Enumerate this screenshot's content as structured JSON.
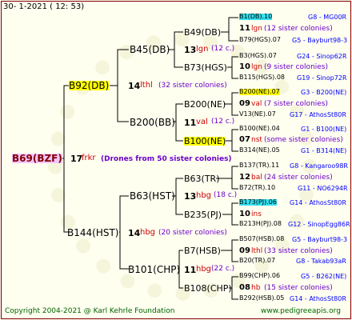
{
  "header": {
    "line": "30-   1-2021  ( 12:  53)"
  },
  "root": {
    "name": "B69(BZF)",
    "count": "17",
    "race": "frkr",
    "colonies": "(Drones from 50 sister colonies)"
  },
  "g2": [
    {
      "name": "B92(DB)",
      "count": "14",
      "race": "lthl",
      "colonies": "(32 sister colonies)"
    },
    {
      "name": "B144(HST)",
      "count": "14",
      "race": "hbg",
      "colonies": "(20 sister colonies)"
    }
  ],
  "g3": [
    {
      "name": "B45(DB)",
      "count": "13",
      "race": "lgn",
      "colonies": "(12 c.)"
    },
    {
      "name": "B200(BB)",
      "count": "11",
      "race": "val",
      "colonies": "(12 c.)"
    },
    {
      "name": "B63(HST)",
      "count": "13",
      "race": "hbg",
      "colonies": "(18 c.)"
    },
    {
      "name": "B101(CHP)",
      "count": "11",
      "race": "hbg",
      "colonies": "(22 c.)"
    }
  ],
  "g4": [
    {
      "name": "B49(DB)"
    },
    {
      "name": "B73(HGS)"
    },
    {
      "name": "B200(NE)"
    },
    {
      "name": "B100(NE)"
    },
    {
      "name": "B63(TR)"
    },
    {
      "name": "B235(PJ)"
    },
    {
      "name": "B7(HSB)"
    },
    {
      "name": "B108(CHP)"
    }
  ],
  "g5": [
    {
      "top": "B1(DB).10",
      "topR": "G8 - MG00R",
      "count": "11",
      "race": "lgn",
      "colonies": "(12 sister colonies)",
      "bot": "B79(HGS).07",
      "botR": "G5 - Bayburt98-3"
    },
    {
      "top": "B3(HGS).07",
      "topR": "G24 - Sinop62R",
      "count": "10",
      "race": "lgn",
      "colonies": "(9 sister colonies)",
      "bot": "B115(HGS).08",
      "botR": "G19 - Sinop72R"
    },
    {
      "top": "B200(NE).07",
      "topR": "G3 - B200(NE)",
      "count": "09",
      "race": "val",
      "colonies": "(7 sister colonies)",
      "bot": "V13(NE).07",
      "botR": "G17 - AthosSt80R"
    },
    {
      "top": "B100(NE).04",
      "topR": "G1 - B100(NE)",
      "count": "07",
      "race": "nst",
      "colonies": "(some sister colonies)",
      "bot": "B314(NE).05",
      "botR": "G1 - B314(NE)"
    },
    {
      "top": "B137(TR).11",
      "topR": "G8 - Kangaroo98R",
      "count": "12",
      "race": "bal",
      "colonies": "(24 sister colonies)",
      "bot": "B72(TR).10",
      "botR": "G11 - NO6294R"
    },
    {
      "top": "B173(PJ).06",
      "topR": "G14 - AthosSt80R",
      "count": "10",
      "race": "ins",
      "colonies": "",
      "bot": "B213H(PJ).08",
      "botR": "G12 - SinopEgg86R"
    },
    {
      "top": "B507(HSB).08",
      "topR": "G5 - Bayburt98-3",
      "count": "09",
      "race": "lthl",
      "colonies": "(33 sister colonies)",
      "bot": "B20(TR).07",
      "botR": "G8 - Takab93aR"
    },
    {
      "top": "B99(CHP).06",
      "topR": "G5 - B262(NE)",
      "count": "08",
      "race": "hb",
      "colonies": "(15 sister colonies)",
      "bot": "B292(HSB).05",
      "botR": "G14 - AthosSt80R"
    }
  ],
  "footer": {
    "left": "Copyright 2004-2021 @ Karl Kehrle Foundation",
    "right": "www.pedigreeapis.org"
  }
}
